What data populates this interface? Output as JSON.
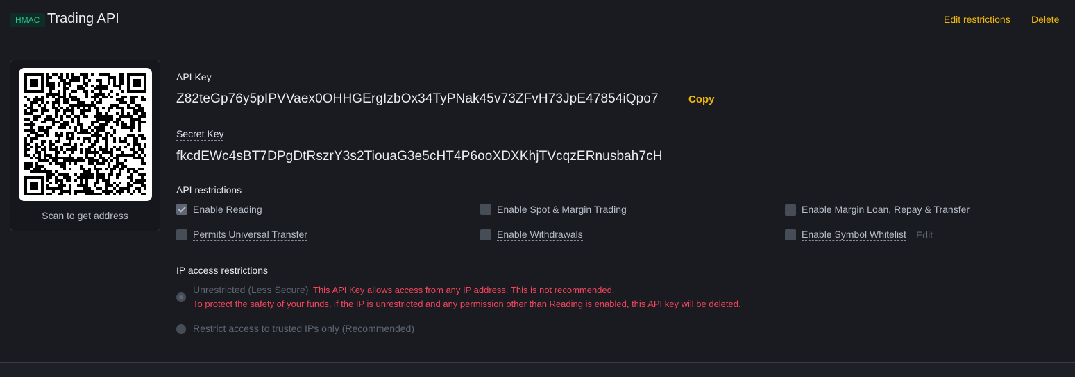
{
  "header": {
    "badge": "HMAC",
    "title": "Trading API",
    "edit_restrictions": "Edit restrictions",
    "delete": "Delete"
  },
  "qr": {
    "caption": "Scan to get address"
  },
  "api_key": {
    "label": "API Key",
    "value": "Z82teGp76y5pIPVVaex0OHHGErgIzbOx34TyPNak45v73ZFvH73JpE47854iQpo7",
    "copy": "Copy"
  },
  "secret_key": {
    "label": "Secret Key",
    "value": "fkcdEWc4sBT7DPgDtRszrY3s2TiouaG3e5cHT4P6ooXDXKhjTVcqzERnusbah7cH"
  },
  "restrictions": {
    "title": "API restrictions",
    "items": [
      {
        "label": "Enable Reading",
        "checked": true
      },
      {
        "label": "Enable Spot & Margin Trading",
        "checked": false
      },
      {
        "label": "Enable Margin Loan, Repay & Transfer",
        "checked": false
      },
      {
        "label": "Permits Universal Transfer",
        "checked": false
      },
      {
        "label": "Enable Withdrawals",
        "checked": false
      },
      {
        "label": "Enable Symbol Whitelist",
        "checked": false
      }
    ],
    "whitelist_edit": "Edit"
  },
  "ip": {
    "title": "IP access restrictions",
    "unrestricted_label": "Unrestricted (Less Secure)",
    "warning_line1": "This API Key allows access from any IP address. This is not recommended.",
    "warning_line2": "To protect the safety of your funds, if the IP is unrestricted and any permission other than Reading is enabled, this API key will be deleted.",
    "restricted_label": "Restrict access to trusted IPs only (Recommended)"
  },
  "colors": {
    "accent": "#f0b90b",
    "warning": "#f6465d",
    "badge": "#2ebd85"
  }
}
